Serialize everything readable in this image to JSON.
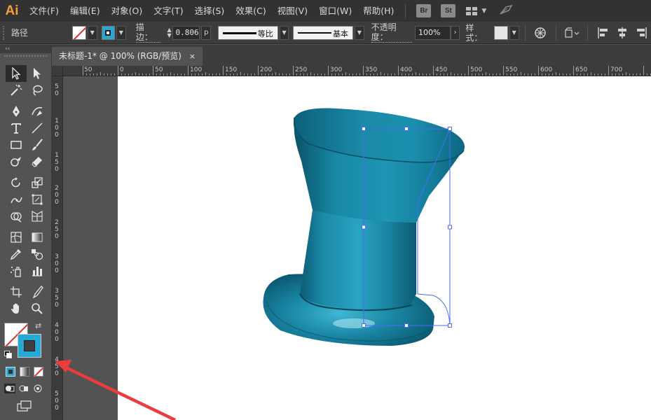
{
  "app": {
    "logo": "Ai",
    "menu": [
      "文件(F)",
      "编辑(E)",
      "对象(O)",
      "文字(T)",
      "选择(S)",
      "效果(C)",
      "视图(V)",
      "窗口(W)",
      "帮助(H)"
    ],
    "bridge_badge": "Br",
    "stock_badge": "St"
  },
  "control_bar": {
    "selection_label": "路径",
    "stroke_label": "描边：",
    "stroke_weight": "0.806",
    "stroke_unit": "p",
    "profile_label": "等比",
    "brush_label": "基本",
    "opacity_label": "不透明度：",
    "opacity_value": "100%",
    "style_label": "样式："
  },
  "document": {
    "tab_title": "未标题-1* @ 100% (RGB/预览)",
    "close_glyph": "×"
  },
  "toolbar": {
    "collapse_glyph": "‹‹"
  },
  "rulers": {
    "top": [
      "50",
      "0",
      "50",
      "100",
      "150",
      "200",
      "250",
      "300",
      "350",
      "400",
      "450",
      "500",
      "550",
      "600",
      "650",
      "700"
    ],
    "left": [
      "50",
      "100",
      "150",
      "200",
      "250",
      "300",
      "350",
      "400",
      "450",
      "500"
    ]
  },
  "colors": {
    "shape_teal": "#1a87a6",
    "selection_blue": "#4a6cf7",
    "annotation_arrow": "#ee3b3b",
    "fill_none_red": "#e42c2c",
    "stroke_swatch": "#27a9d6"
  }
}
